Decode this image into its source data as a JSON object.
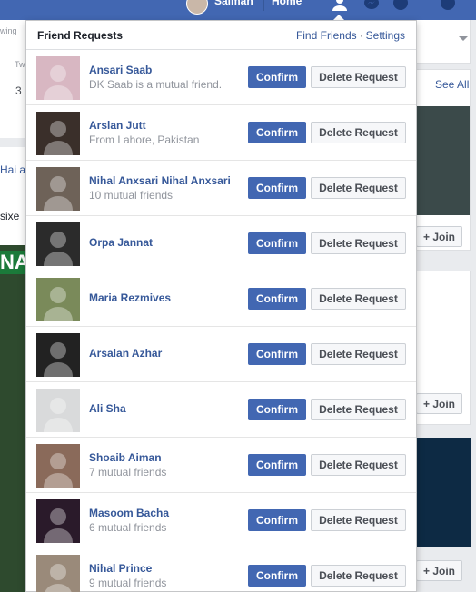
{
  "topbar": {
    "user_name": "Salman",
    "home_label": "Home"
  },
  "background": {
    "tab_label": "wing",
    "tab_count": "Tw",
    "count": "3",
    "left_text_1": "Hai a",
    "left_text_2": "sixe",
    "left_text_3": "NA",
    "see_all": "See All",
    "join_label": "+ Join"
  },
  "popup": {
    "title": "Friend Requests",
    "find_friends": "Find Friends",
    "link_separator": "·",
    "settings": "Settings",
    "confirm_label": "Confirm",
    "delete_label": "Delete Request",
    "requests": [
      {
        "name": "Ansari Saab",
        "subtitle": "DK Saab is a mutual friend.",
        "avatar": "#d8b7c2"
      },
      {
        "name": "Arslan Jutt",
        "subtitle": "From Lahore, Pakistan",
        "avatar": "#3a2f2a"
      },
      {
        "name": "Nihal Anxsari Nihal Anxsari",
        "subtitle": "10 mutual friends",
        "avatar": "#6e6258"
      },
      {
        "name": "Orpa Jannat",
        "subtitle": "",
        "avatar": "#2b2b2b"
      },
      {
        "name": "Maria Rezmives",
        "subtitle": "",
        "avatar": "#7a8a5a"
      },
      {
        "name": "Arsalan Azhar",
        "subtitle": "",
        "avatar": "#222222"
      },
      {
        "name": "Ali Sha",
        "subtitle": "",
        "avatar": "#d9dadb"
      },
      {
        "name": "Shoaib Aiman",
        "subtitle": "7 mutual friends",
        "avatar": "#8a6a5a"
      },
      {
        "name": "Masoom Bacha",
        "subtitle": "6 mutual friends",
        "avatar": "#2a1a2a"
      },
      {
        "name": "Nihal Prince",
        "subtitle": "9 mutual friends",
        "avatar": "#9a8a7a"
      }
    ]
  },
  "colors": {
    "fb_blue": "#4267b2",
    "link_blue": "#365899",
    "gray_text": "#90949c"
  }
}
